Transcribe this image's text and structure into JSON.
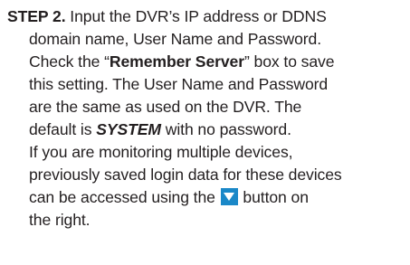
{
  "step": {
    "label": "STEP 2.",
    "lines": {
      "l1": " Input the DVR’s IP address or DDNS",
      "l2": "domain name, User Name and Password.",
      "l3_a": "Check the “",
      "l3_b": "Remember Server",
      "l3_c": "” box to save",
      "l4": "this setting. The User Name and Password",
      "l5": "are the same as used on the DVR. The",
      "l6_a": "default is ",
      "l6_b": "SYSTEM",
      "l6_c": " with no password.",
      "l7": "If you are monitoring multiple devices,",
      "l8": "previously saved login data for these devices",
      "l9_a": "can be accessed using the ",
      "l9_b": " button on",
      "l10": "the right."
    }
  },
  "icons": {
    "dropdown_button": "dropdown-arrow-icon",
    "dropdown_color": "#1a88c8"
  }
}
